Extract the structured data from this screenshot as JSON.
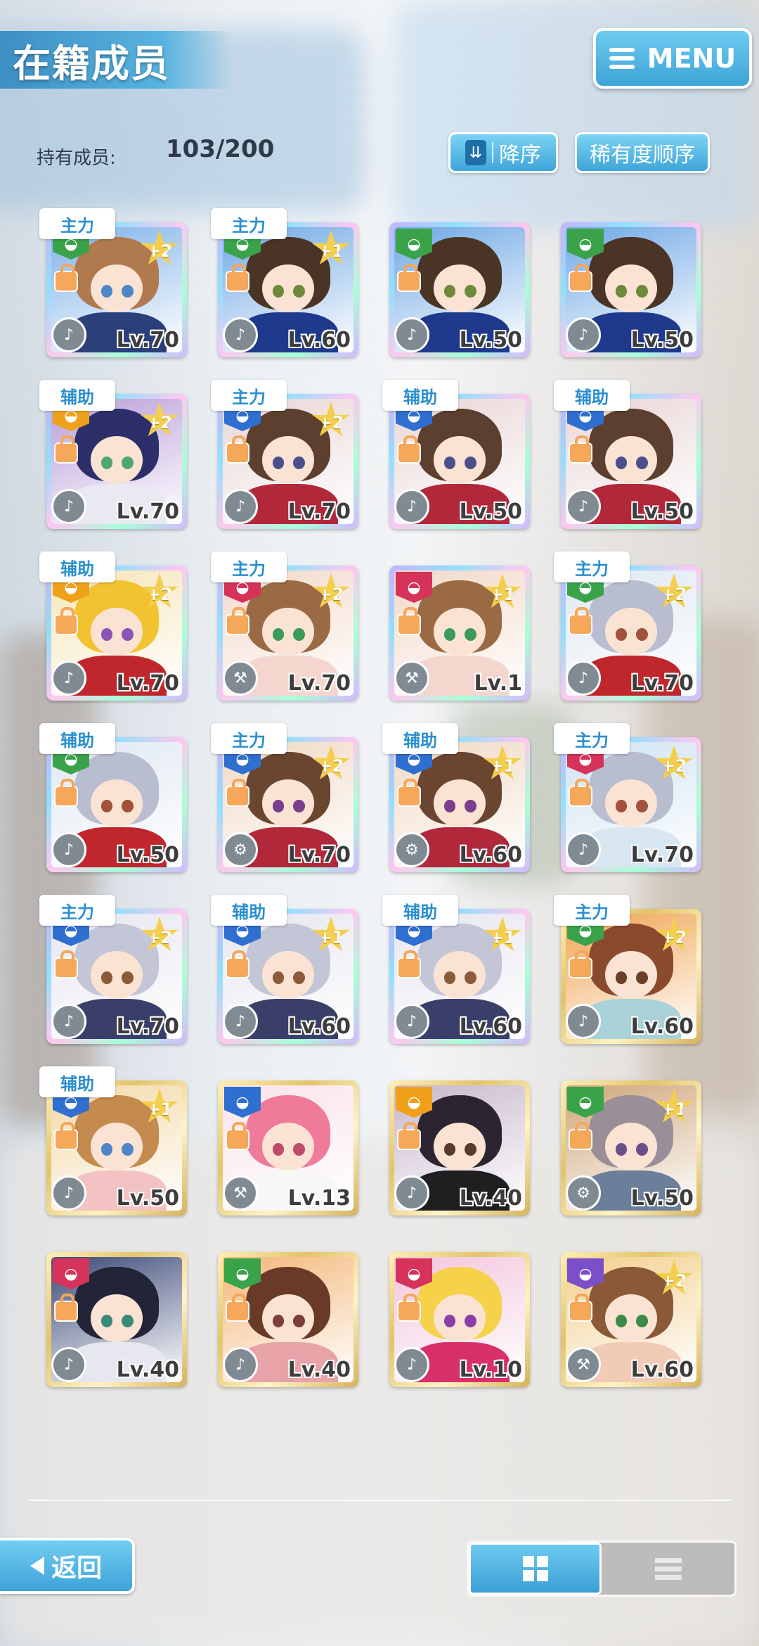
{
  "header": {
    "title": "在籍成员",
    "menu_label": "MENU"
  },
  "members": {
    "held_label": "持有成员:",
    "held_count": "103/200",
    "sort_order_label": "降序",
    "sort_key_label": "稀有度顺序"
  },
  "cards": [
    {
      "role": "主力",
      "plus": "+2",
      "level": "Lv.70",
      "frame": "rainbow",
      "badge_color": "#3aa34a",
      "skill": "flute",
      "hair": "#b07a4e",
      "outfit": "#2b3f7a",
      "eyes": "#4f86c6",
      "bg": "#7fb2e8"
    },
    {
      "role": "主力",
      "plus": "+1",
      "level": "Lv.60",
      "frame": "rainbow",
      "badge_color": "#3aa34a",
      "skill": "flute",
      "hair": "#4a3426",
      "outfit": "#1f3a8c",
      "eyes": "#6c8a3a",
      "bg": "#6fa8e4"
    },
    {
      "role": "",
      "plus": "",
      "level": "Lv.50",
      "frame": "rainbow",
      "badge_color": "#3aa34a",
      "skill": "flute",
      "hair": "#4a3426",
      "outfit": "#1f3a8c",
      "eyes": "#6c8a3a",
      "bg": "#6fa8e4"
    },
    {
      "role": "",
      "plus": "",
      "level": "Lv.50",
      "frame": "rainbow",
      "badge_color": "#3aa34a",
      "skill": "flute",
      "hair": "#4a3426",
      "outfit": "#1f3a8c",
      "eyes": "#6c8a3a",
      "bg": "#6fa8e4"
    },
    {
      "role": "辅助",
      "plus": "+2",
      "level": "Lv.70",
      "frame": "rainbow",
      "badge_color": "#f0a11c",
      "skill": "flute",
      "hair": "#2d2f6b",
      "outfit": "#e9e9f2",
      "eyes": "#4fa76f",
      "bg": "#b99ed8"
    },
    {
      "role": "主力",
      "plus": "+2",
      "level": "Lv.70",
      "frame": "rainbow",
      "badge_color": "#2f6fd0",
      "skill": "flute",
      "hair": "#5c3f2e",
      "outfit": "#b0283a",
      "eyes": "#4b4f8c",
      "bg": "#e9d6d6"
    },
    {
      "role": "辅助",
      "plus": "",
      "level": "Lv.50",
      "frame": "rainbow",
      "badge_color": "#2f6fd0",
      "skill": "flute",
      "hair": "#5c3f2e",
      "outfit": "#b0283a",
      "eyes": "#4b4f8c",
      "bg": "#e9d6d6"
    },
    {
      "role": "辅助",
      "plus": "",
      "level": "Lv.50",
      "frame": "rainbow",
      "badge_color": "#2f6fd0",
      "skill": "flute",
      "hair": "#5c3f2e",
      "outfit": "#b0283a",
      "eyes": "#4b4f8c",
      "bg": "#e9d6d6"
    },
    {
      "role": "辅助",
      "plus": "+2",
      "level": "Lv.70",
      "frame": "rainbow",
      "badge_color": "#f0a11c",
      "skill": "flute",
      "hair": "#f2c230",
      "outfit": "#c0272d",
      "eyes": "#8b55b8",
      "bg": "#f5e6b8"
    },
    {
      "role": "主力",
      "plus": "+2",
      "level": "Lv.70",
      "frame": "rainbow",
      "badge_color": "#d6335a",
      "skill": "hammer",
      "hair": "#9a6a44",
      "outfit": "#f4d6cf",
      "eyes": "#3d9a5a",
      "bg": "#f2d9c9"
    },
    {
      "role": "",
      "plus": "+1",
      "level": "Lv.1",
      "frame": "rainbow",
      "badge_color": "#d6335a",
      "skill": "hammer",
      "hair": "#9a6a44",
      "outfit": "#f4d6cf",
      "eyes": "#3d9a5a",
      "bg": "#f2d9c9"
    },
    {
      "role": "主力",
      "plus": "+2",
      "level": "Lv.70",
      "frame": "rainbow",
      "badge_color": "#3aa34a",
      "skill": "flute",
      "hair": "#b9bdd0",
      "outfit": "#c0272d",
      "eyes": "#a2523a",
      "bg": "#dfe8f2"
    },
    {
      "role": "辅助",
      "plus": "",
      "level": "Lv.50",
      "frame": "rainbow",
      "badge_color": "#3aa34a",
      "skill": "flute",
      "hair": "#b9bdd0",
      "outfit": "#c0272d",
      "eyes": "#a2523a",
      "bg": "#dfe8f2"
    },
    {
      "role": "主力",
      "plus": "+2",
      "level": "Lv.70",
      "frame": "rainbow",
      "badge_color": "#2f6fd0",
      "skill": "gear",
      "hair": "#6a4530",
      "outfit": "#b0283a",
      "eyes": "#7a3f8c",
      "bg": "#f0d9c4"
    },
    {
      "role": "辅助",
      "plus": "+1",
      "level": "Lv.60",
      "frame": "rainbow",
      "badge_color": "#2f6fd0",
      "skill": "gear",
      "hair": "#6a4530",
      "outfit": "#b0283a",
      "eyes": "#7a3f8c",
      "bg": "#f0d9c4"
    },
    {
      "role": "主力",
      "plus": "+2",
      "level": "Lv.70",
      "frame": "rainbow",
      "badge_color": "#d6335a",
      "skill": "flute",
      "hair": "#b9bdd0",
      "outfit": "#d8e6f2",
      "eyes": "#a2523a",
      "bg": "#cfe3f2"
    },
    {
      "role": "主力",
      "plus": "+2",
      "level": "Lv.70",
      "frame": "rainbow",
      "badge_color": "#2f6fd0",
      "skill": "flute",
      "hair": "#c3c6d6",
      "outfit": "#3a3f6a",
      "eyes": "#8a5a3a",
      "bg": "#e6e6ef"
    },
    {
      "role": "辅助",
      "plus": "+1",
      "level": "Lv.60",
      "frame": "rainbow",
      "badge_color": "#2f6fd0",
      "skill": "flute",
      "hair": "#c3c6d6",
      "outfit": "#3a3f6a",
      "eyes": "#8a5a3a",
      "bg": "#e6e6ef"
    },
    {
      "role": "辅助",
      "plus": "+1",
      "level": "Lv.60",
      "frame": "rainbow",
      "badge_color": "#2f6fd0",
      "skill": "flute",
      "hair": "#c3c6d6",
      "outfit": "#3a3f6a",
      "eyes": "#8a5a3a",
      "bg": "#e6e6ef"
    },
    {
      "role": "主力",
      "plus": "+2",
      "level": "Lv.60",
      "frame": "gold",
      "badge_color": "#3aa34a",
      "skill": "flute",
      "hair": "#8a4a2e",
      "outfit": "#a9d2d8",
      "eyes": "#6a3f2a",
      "bg": "#f0a452"
    },
    {
      "role": "辅助",
      "plus": "+1",
      "level": "Lv.50",
      "frame": "gold",
      "badge_color": "#2f6fd0",
      "skill": "flute",
      "hair": "#c48a4e",
      "outfit": "#f3c2c2",
      "eyes": "#4f86c6",
      "bg": "#f2d9a8"
    },
    {
      "role": "",
      "plus": "",
      "level": "Lv.13",
      "frame": "gold",
      "badge_color": "#2f6fd0",
      "skill": "hammer",
      "hair": "#f07a9a",
      "outfit": "#f7f7f7",
      "eyes": "#c04a6a",
      "bg": "#f9e3ea"
    },
    {
      "role": "",
      "plus": "",
      "level": "Lv.40",
      "frame": "gold",
      "badge_color": "#f0a11c",
      "skill": "flute",
      "hair": "#2c2430",
      "outfit": "#1f1f22",
      "eyes": "#5a3a2a",
      "bg": "#c8b7cc"
    },
    {
      "role": "",
      "plus": "+1",
      "level": "Lv.50",
      "frame": "gold",
      "badge_color": "#3aa34a",
      "skill": "gear",
      "hair": "#9a8f98",
      "outfit": "#6b7f9a",
      "eyes": "#6a4f8a",
      "bg": "#cfa67a"
    },
    {
      "role": "",
      "plus": "",
      "level": "Lv.40",
      "frame": "gold",
      "badge_color": "#d6335a",
      "skill": "flute",
      "hair": "#222438",
      "outfit": "#e7e7ef",
      "eyes": "#3a8a7a",
      "bg": "#3d4a78"
    },
    {
      "role": "",
      "plus": "",
      "level": "Lv.40",
      "frame": "gold",
      "badge_color": "#3aa34a",
      "skill": "flute",
      "hair": "#6a3a28",
      "outfit": "#e7a3a8",
      "eyes": "#7a3f3a",
      "bg": "#f3b77a"
    },
    {
      "role": "",
      "plus": "",
      "level": "Lv.10",
      "frame": "gold",
      "badge_color": "#d6335a",
      "skill": "flute",
      "hair": "#f5d24a",
      "outfit": "#d8306a",
      "eyes": "#8a3fa8",
      "bg": "#f3c6dd"
    },
    {
      "role": "",
      "plus": "+2",
      "level": "Lv.60",
      "frame": "gold",
      "badge_color": "#7a4fc8",
      "skill": "hammer",
      "hair": "#8a5a38",
      "outfit": "#f1cbb6",
      "eyes": "#3d8a4a",
      "bg": "#f3cf8f"
    }
  ],
  "footer": {
    "back_label": "返回"
  }
}
